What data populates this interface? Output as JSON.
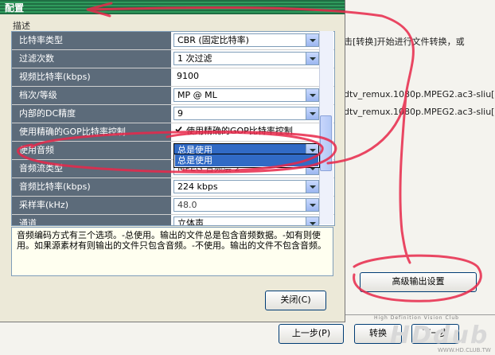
{
  "background_window": {
    "lines": [
      "击[转换]开始进行文件转换，或",
      "dtv_remux.1080p.MPEG2.ac3-sliu[",
      "dtv_remux.1080p.MPEG2.ac3-sliu["
    ],
    "advanced_button": "高级输出设置",
    "prev_button": "上一步(P)",
    "convert_button": "转换",
    "next_button": "下一步"
  },
  "dialog": {
    "title": "配置",
    "desc_label": "描述",
    "rows": [
      {
        "label": "比特率类型",
        "value": "CBR (固定比特率)",
        "dropdown": true
      },
      {
        "label": "过滤次数",
        "value": "1 次过滤",
        "dropdown": true
      },
      {
        "label": "视频比特率(kbps)",
        "value": "9100",
        "dropdown": false
      },
      {
        "label": "档次/等级",
        "value": "MP @ ML",
        "dropdown": true
      },
      {
        "label": "内部的DC精度",
        "value": "9",
        "dropdown": true
      },
      {
        "label": "使用精确的GOP比特率控制",
        "value": "使用精确的GOP比特率控制",
        "checkbox": true
      },
      {
        "label": "使用音频",
        "value": "总是使用",
        "dropdown": true,
        "selected": true
      },
      {
        "label": "音频流类型",
        "value": "MPEG 音频层 2",
        "dropdown": true
      },
      {
        "label": "音频比特率(kbps)",
        "value": "224 kbps",
        "dropdown": true
      },
      {
        "label": "采样率(kHz)",
        "value": "48.0",
        "dropdown": true
      },
      {
        "label": "通道",
        "value": "立体声",
        "dropdown": true
      }
    ],
    "dropdown_open_item": "总是使用",
    "description": "音频编码方式有三个选项。-总使用。输出的文件总是包含音频数据。-如有则使用。如果源素材有则输出的文件只包含音频。-不使用。输出的文件不包含音频。",
    "close_button": "关闭(C)"
  },
  "watermark": {
    "subtitle": "High Definition Vision Club",
    "main": "HDdub",
    "url": "WWW.HD.CLUB.TW"
  },
  "colors": {
    "title_green": "#2f9a5c",
    "label_bg": "#5c6b7a",
    "annotation_red": "#e8284a",
    "selection_blue": "#316ac5"
  }
}
